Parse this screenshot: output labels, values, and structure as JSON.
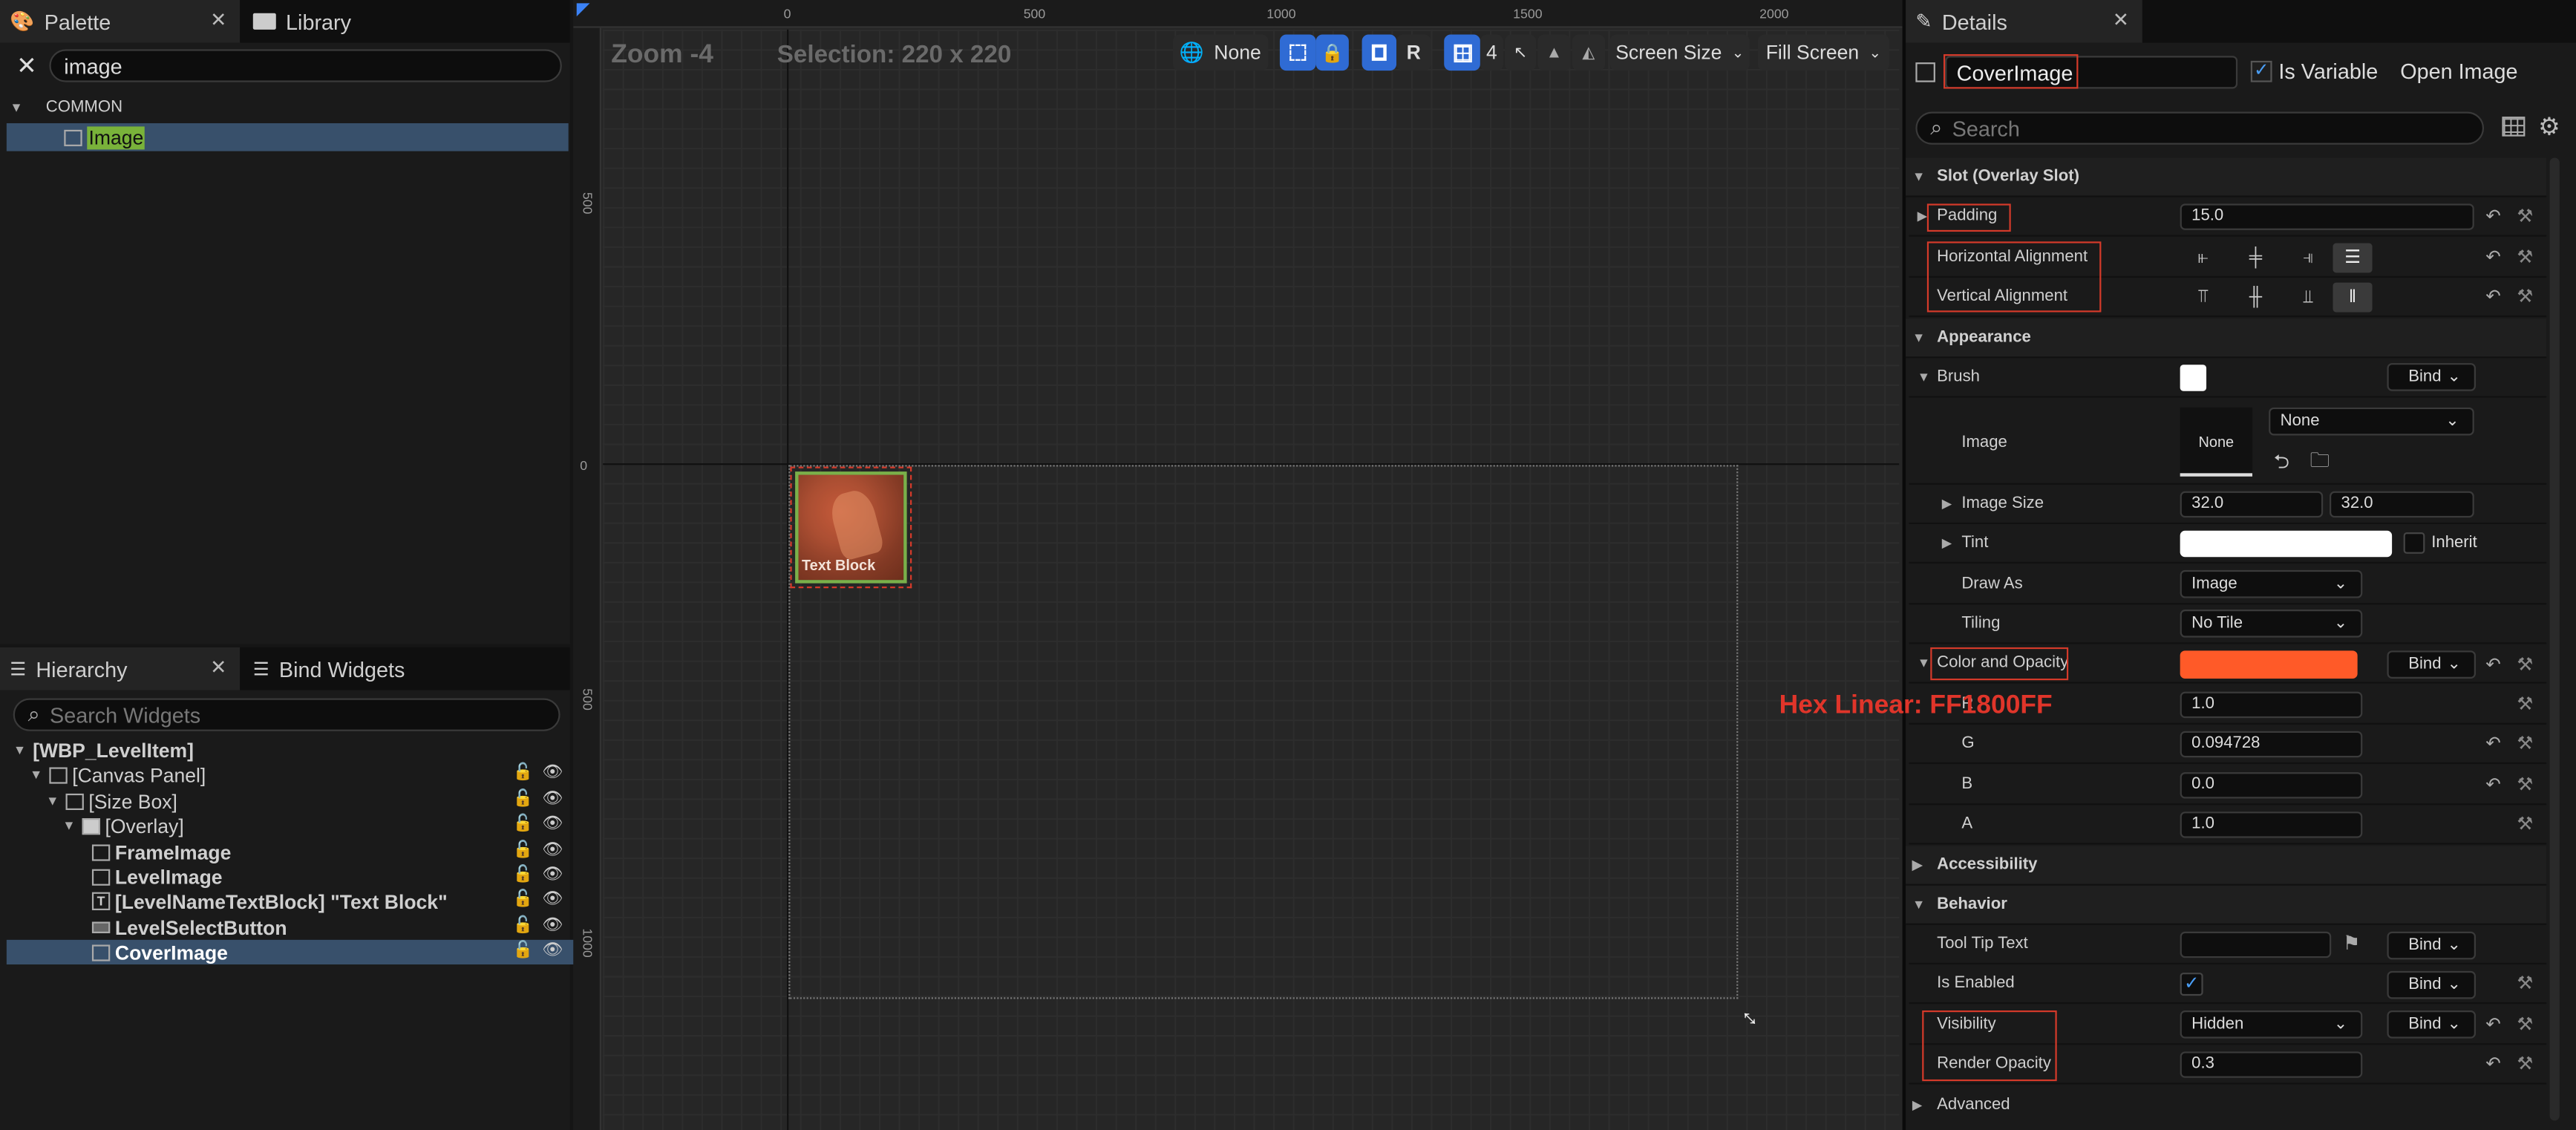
{
  "palette": {
    "tab_label": "Palette",
    "library_tab_label": "Library",
    "search_value": "image",
    "category": "COMMON",
    "item": "Image"
  },
  "hierarchy": {
    "tab_label": "Hierarchy",
    "bind_widgets_tab_label": "Bind Widgets",
    "search_placeholder": "Search Widgets",
    "items": [
      {
        "label": "[WBP_LevelItem]"
      },
      {
        "label": "[Canvas Panel]"
      },
      {
        "label": "[Size Box]"
      },
      {
        "label": "[Overlay]"
      },
      {
        "label": "FrameImage"
      },
      {
        "label": "LevelImage"
      },
      {
        "label": "[LevelNameTextBlock] \"Text Block\""
      },
      {
        "label": "LevelSelectButton"
      },
      {
        "label": "CoverImage"
      }
    ]
  },
  "viewport": {
    "zoom": "Zoom -4",
    "selection": "Selection: 220 x 220",
    "ruler_top": [
      "0",
      "500",
      "1000",
      "1500",
      "2000"
    ],
    "ruler_left": [
      "500",
      "0",
      "500",
      "1000"
    ],
    "toolbar": {
      "none_label": "None",
      "r_label": "R",
      "grid_value": "4",
      "screen_size": "Screen Size",
      "fill_screen": "Fill Screen"
    },
    "widget_text": "Text Block",
    "annotation": "Hex Linear: FF1800FF"
  },
  "details": {
    "tab_label": "Details",
    "widget_name": "CoverImage",
    "is_variable_label": "Is Variable",
    "is_variable": true,
    "open_image": "Open Image",
    "search_placeholder": "Search",
    "sections": {
      "slot": "Slot (Overlay Slot)",
      "appearance": "Appearance",
      "accessibility": "Accessibility",
      "behavior": "Behavior",
      "advanced": "Advanced"
    },
    "padding": {
      "label": "Padding",
      "value": "15.0"
    },
    "horizontal_alignment": {
      "label": "Horizontal Alignment"
    },
    "vertical_alignment": {
      "label": "Vertical Alignment"
    },
    "brush": {
      "label": "Brush",
      "bind": "Bind"
    },
    "image": {
      "label": "Image",
      "thumb": "None",
      "value": "None"
    },
    "image_size": {
      "label": "Image Size",
      "x": "32.0",
      "y": "32.0"
    },
    "tint": {
      "label": "Tint",
      "inherit": "Inherit"
    },
    "draw_as": {
      "label": "Draw As",
      "value": "Image"
    },
    "tiling": {
      "label": "Tiling",
      "value": "No Tile"
    },
    "color_and_opacity": {
      "label": "Color and Opacity",
      "bind": "Bind",
      "color": "#ff5a28"
    },
    "channels": [
      {
        "label": "R",
        "value": "1.0"
      },
      {
        "label": "G",
        "value": "0.094728"
      },
      {
        "label": "B",
        "value": "0.0"
      },
      {
        "label": "A",
        "value": "1.0"
      }
    ],
    "tool_tip_text": {
      "label": "Tool Tip Text",
      "bind": "Bind"
    },
    "is_enabled": {
      "label": "Is Enabled",
      "bind": "Bind",
      "checked": true
    },
    "visibility": {
      "label": "Visibility",
      "value": "Hidden",
      "bind": "Bind"
    },
    "render_opacity": {
      "label": "Render Opacity",
      "value": "0.3"
    }
  },
  "colors": {
    "accent_blue": "#2f6bd4",
    "highlight_red": "#d43a2a",
    "selection_row": "#38506b"
  }
}
